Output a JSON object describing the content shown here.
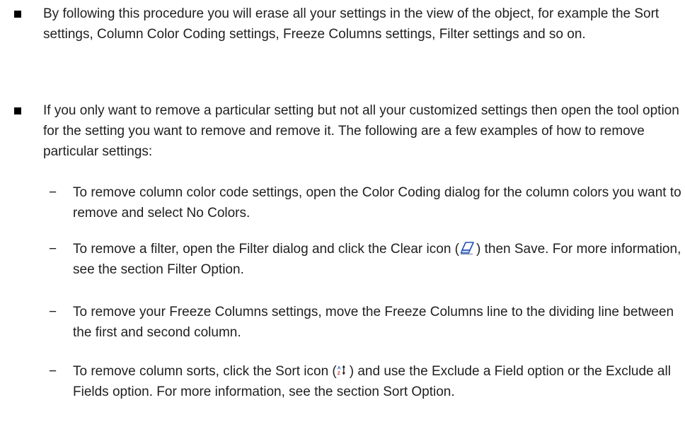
{
  "content": {
    "bullets": [
      {
        "text": "By following this procedure you will erase all your settings in the view of the object, for example the Sort settings, Column Color Coding settings, Freeze Columns settings, Filter settings and so on."
      },
      {
        "text": "If you only want to remove a particular setting but not all your customized settings then open the tool option for the setting you want to remove and remove it. The following are a few examples of how to remove particular settings:"
      }
    ],
    "sub_bullets": [
      {
        "marker": "−",
        "text": "To remove column color code settings, open the Color Coding dialog for the column colors you want to remove and select No Colors."
      },
      {
        "marker": "−",
        "text_before_icon": "To remove a filter, open the Filter dialog and click the Clear icon (",
        "icon": "eraser-icon",
        "text_after_icon": ") then Save. For more information, see the section Filter Option."
      },
      {
        "marker": "−",
        "text": "To remove your Freeze Columns settings, move the Freeze Columns line to the dividing line between the first and second column."
      },
      {
        "marker": "−",
        "text_before_icon": "To remove column sorts, click the Sort icon (",
        "icon": "sort-az-icon",
        "text_after_icon": ") and use the Exclude a Field option or the Exclude all Fields option. For more information, see the section Sort Option."
      }
    ]
  }
}
